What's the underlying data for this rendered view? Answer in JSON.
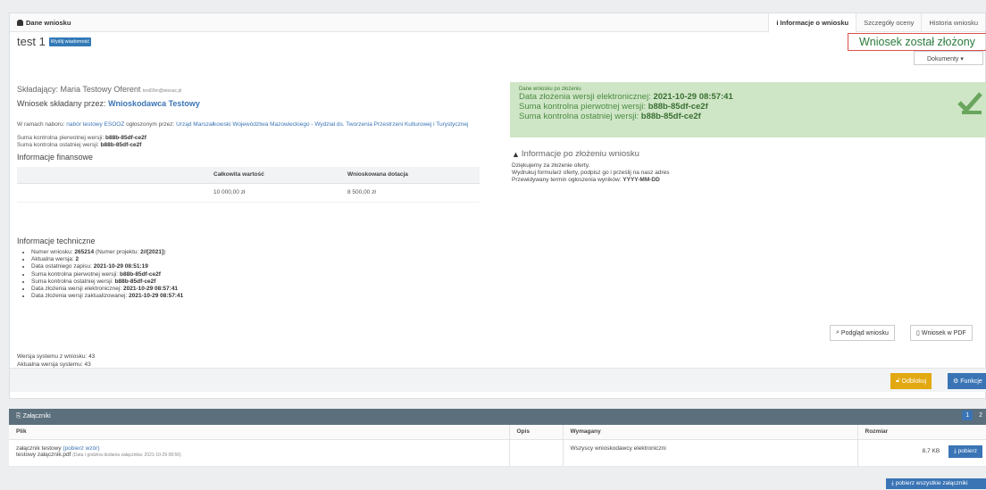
{
  "panel": {
    "title": "Dane wniosku",
    "tabs": [
      "Informacje o wniosku",
      "Szczegóły oceny",
      "Historia wniosku"
    ]
  },
  "app": {
    "title": "test 1",
    "send_button": "Wyślij wiadomość",
    "status": "Wniosek został złożony",
    "documents_button": "Dokumenty ▾"
  },
  "applicant": {
    "name_label": "Składający: Maria Testowy Oferent",
    "email": "test03m@wiosac.pl",
    "submitted_by_label": "Wniosek składany przez:",
    "submitted_by_link": "Wnioskodawca Testowy",
    "nabor_prefix": "W ramach naboru:",
    "nabor_link": "nabór testowy ESOOZ",
    "nabor_mid": "ogłoszonym przez:",
    "organizer_link": "Urząd Marszałkowski Województwa Mazowieckiego - Wydział ds. Tworzenia Przestrzeni Kulturowej i Turystycznej",
    "sum_first_label": "Suma kontrolna pierwotnej wersji:",
    "sum_first_value": "b88b-85df-ce2f",
    "sum_last_label": "Suma kontrolna ostatniej wersji:",
    "sum_last_value": "b88b-85df-ce2f"
  },
  "financial": {
    "title": "Informacje finansowe",
    "columns": [
      "",
      "Całkowita wartość",
      "Wnioskowana dotacja"
    ],
    "row": [
      "",
      "10 000,00 zł",
      "8 500,00 zł"
    ]
  },
  "technical": {
    "title": "Informacje techniczne",
    "items": [
      {
        "label": "Numer wniosku:",
        "value": "265214",
        "extra_label": "(Numer projektu:",
        "extra_value": "2//[2021]",
        "extra_close": ")"
      },
      {
        "label": "Aktualna wersja:",
        "value": "2"
      },
      {
        "label": "Data ostatniego zapisu:",
        "value": "2021-10-29 08:51:19"
      },
      {
        "label": "Suma kontrolna pierwotnej wersji:",
        "value": "b88b-85df-ce2f"
      },
      {
        "label": "Suma kontrolna ostatniej wersji:",
        "value": "b88b-85df-ce2f"
      },
      {
        "label": "Data złożenia wersji elektronicznej:",
        "value": "2021-10-29 08:57:41"
      },
      {
        "label": "Data złożenia wersji zaktualizowanej:",
        "value": "2021-10-29 08:57:41"
      }
    ],
    "system_version_app": "Wersja systemu z wniosku: 43",
    "system_version_current": "Aktualna wersja systemu: 43"
  },
  "submitted_info": {
    "header": "Dane wniosku po złożeniu",
    "date_label": "Data złożenia wersji elektronicznej:",
    "date_value": "2021-10-29 08:57:41",
    "sum_first_label": "Suma kontrolna pierwotnej wersji:",
    "sum_first_value": "b88b-85df-ce2f",
    "sum_last_label": "Suma kontrolna ostatniej wersji:",
    "sum_last_value": "b88b-85df-ce2f",
    "success_color": "#cfe6c6"
  },
  "after_submit": {
    "title": "Informacje po złożeniu wniosku",
    "line1": "Dziękujemy za złożenie oferty.",
    "line2": "Wydrukuj formularz oferty, podpisz go i prześlij na nasz adres",
    "line3_label": "Przewidywany termin ogłoszenia wyników:",
    "line3_value": "YYYY-MM-DD"
  },
  "buttons": {
    "preview": "Podgląd wniosku",
    "pdf": "Wniosek w PDF",
    "unlock": "Odblokuj",
    "functions": "Funkcje"
  },
  "attachments": {
    "title": "Załączniki",
    "pager": [
      "1",
      "2"
    ],
    "columns": [
      "Plik",
      "Opis",
      "Wymagany",
      "Rozmiar"
    ],
    "row": {
      "name": "załącznik testowy",
      "template_link": "(pobierz wzór)",
      "file": "testowy załącznik.pdf",
      "date_note": "(Data i godzina dodania załącznika: 2021-10-29 08:56)",
      "description": "",
      "required": "Wszyscy wnioskodawcy elektroniczni",
      "size": "8,7 KB",
      "download": "pobierz"
    },
    "download_all": "pobierz wszystkie załączniki"
  }
}
